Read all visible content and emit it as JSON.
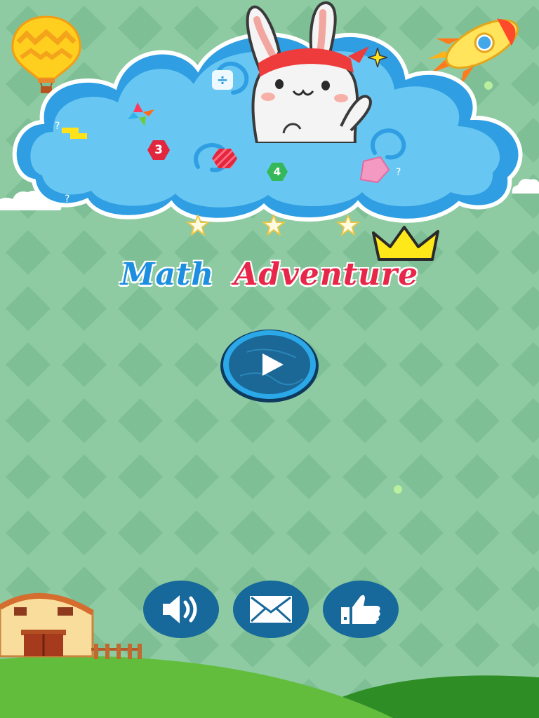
{
  "game": {
    "title_part1": "Math",
    "title_part2": "Adventure"
  },
  "cloud_badges": {
    "badge_3": "3",
    "badge_4": "4",
    "question_mark_1": "?",
    "question_mark_2": "?",
    "division_sign": "÷"
  },
  "buttons": {
    "play": "play-icon",
    "sound": "speaker-icon",
    "mail": "envelope-icon",
    "like": "thumbs-up-icon"
  },
  "colors": {
    "background": "#8ecba2",
    "title_math": "#1e8fe0",
    "title_adventure": "#e8264a",
    "button": "#17689b",
    "grass": "#5fb83a",
    "cloud": "#68c7f2"
  }
}
